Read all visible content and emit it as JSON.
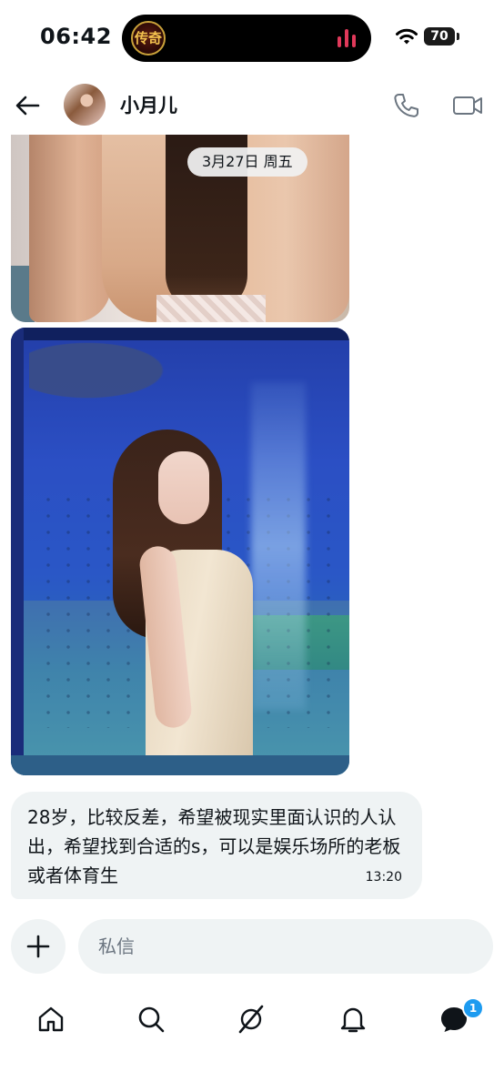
{
  "status_bar": {
    "time": "06:42",
    "island_app_glyph": "传奇",
    "battery": "70"
  },
  "header": {
    "contact_name": "小月儿"
  },
  "chat": {
    "date_separator": "3月27日 周五",
    "messages": [
      {
        "text": "28岁，比较反差，希望被现实里面认识的人认出，希望找到合适的s，可以是娱乐场所的老板或者体育生",
        "time": "13:20"
      }
    ]
  },
  "composer": {
    "placeholder": "私信"
  },
  "nav": {
    "items": [
      "home-icon",
      "search-icon",
      "grok-icon",
      "notifications-icon",
      "messages-icon"
    ],
    "messages_badge": "1"
  },
  "colors": {
    "accent": "#1d9bf0",
    "bubble": "#eff3f4",
    "text": "#0f1419"
  }
}
